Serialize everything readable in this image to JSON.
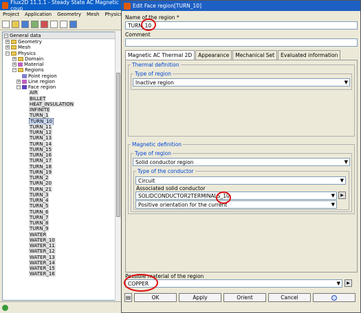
{
  "main": {
    "title": "Flux2D 11.1.1 - Steady State AC Magnetic coup",
    "menu": [
      "Project",
      "Application",
      "Geometry",
      "Mesh",
      "Physics"
    ],
    "tree": {
      "header": "General data",
      "items": [
        "Geometry",
        "Mesh",
        "Physics",
        "Domain",
        "Material",
        "Regions",
        "Point region",
        "Line region",
        "Face region"
      ],
      "face_regions": [
        "AIR",
        "BILLET",
        "HEAT_INSULATION",
        "INFINITE",
        "TURN_1",
        "TURN_10",
        "TURN_11",
        "TURN_12",
        "TURN_13",
        "TURN_14",
        "TURN_15",
        "TURN_16",
        "TURN_17",
        "TURN_18",
        "TURN_19",
        "TURN_2",
        "TURN_20",
        "TURN_21",
        "TURN_3",
        "TURN_4",
        "TURN_5",
        "TURN_6",
        "TURN_7",
        "TURN_8",
        "TURN_9",
        "WATER",
        "WATER_10",
        "WATER_11",
        "WATER_12",
        "WATER_13",
        "WATER_14",
        "WATER_15",
        "WATER_16"
      ]
    }
  },
  "dialog": {
    "title": "Edit Face region[TURN_10]",
    "name_label": "Name of the region *",
    "name_value": "TURN_10",
    "comment_label": "Comment",
    "comment_value": "",
    "tabs": [
      "Magnetic AC Thermal 2D",
      "Appearance",
      "Mechanical Set",
      "Evaluated information"
    ],
    "thermal": {
      "group": "Thermal definition",
      "type_group": "Type of region",
      "type_value": "Inactive region"
    },
    "magnetic": {
      "group": "Magnetic definition",
      "type_group": "Type of region",
      "type_value": "Solid conductor region",
      "conductor_group": "Type of the conductor",
      "conductor_type": "Circuit",
      "assoc_label": "Associated solid conductor",
      "assoc_value": "SOLIDCONDUCTOR2TERMINALS_10",
      "orientation": "Positive orientation for the current"
    },
    "material_label": "Possible material of the region",
    "material_value": "COPPER",
    "buttons": {
      "ok": "OK",
      "apply": "Apply",
      "orient": "Orient",
      "cancel": "Cancel"
    }
  }
}
